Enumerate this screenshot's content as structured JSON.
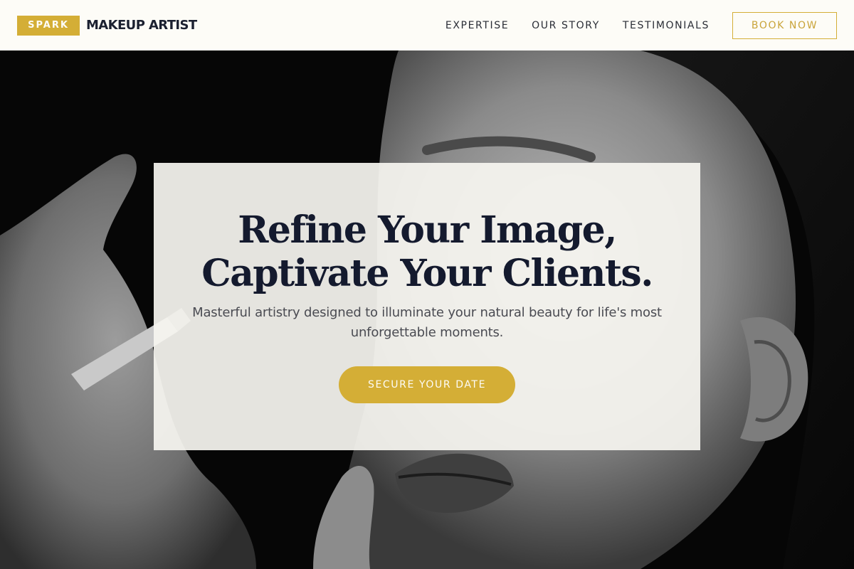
{
  "brand": {
    "badge": "SPARK",
    "name": "MAKEUP ARTIST"
  },
  "nav": {
    "items": [
      {
        "label": "EXPERTISE"
      },
      {
        "label": "OUR STORY"
      },
      {
        "label": "TESTIMONIALS"
      }
    ],
    "book_label": "BOOK NOW"
  },
  "hero": {
    "title_line1": "Refine Your Image,",
    "title_line2": "Captivate Your Clients.",
    "subtitle": "Masterful artistry designed to illuminate your natural beauty for life's most unforgettable moments.",
    "cta_label": "SECURE YOUR DATE",
    "image": "black-and-white-makeup-application-photo"
  },
  "colors": {
    "accent": "#d4ae36",
    "header_bg": "#fdfcf7",
    "heading": "#141a2e",
    "card_bg": "#f6f5f0"
  }
}
